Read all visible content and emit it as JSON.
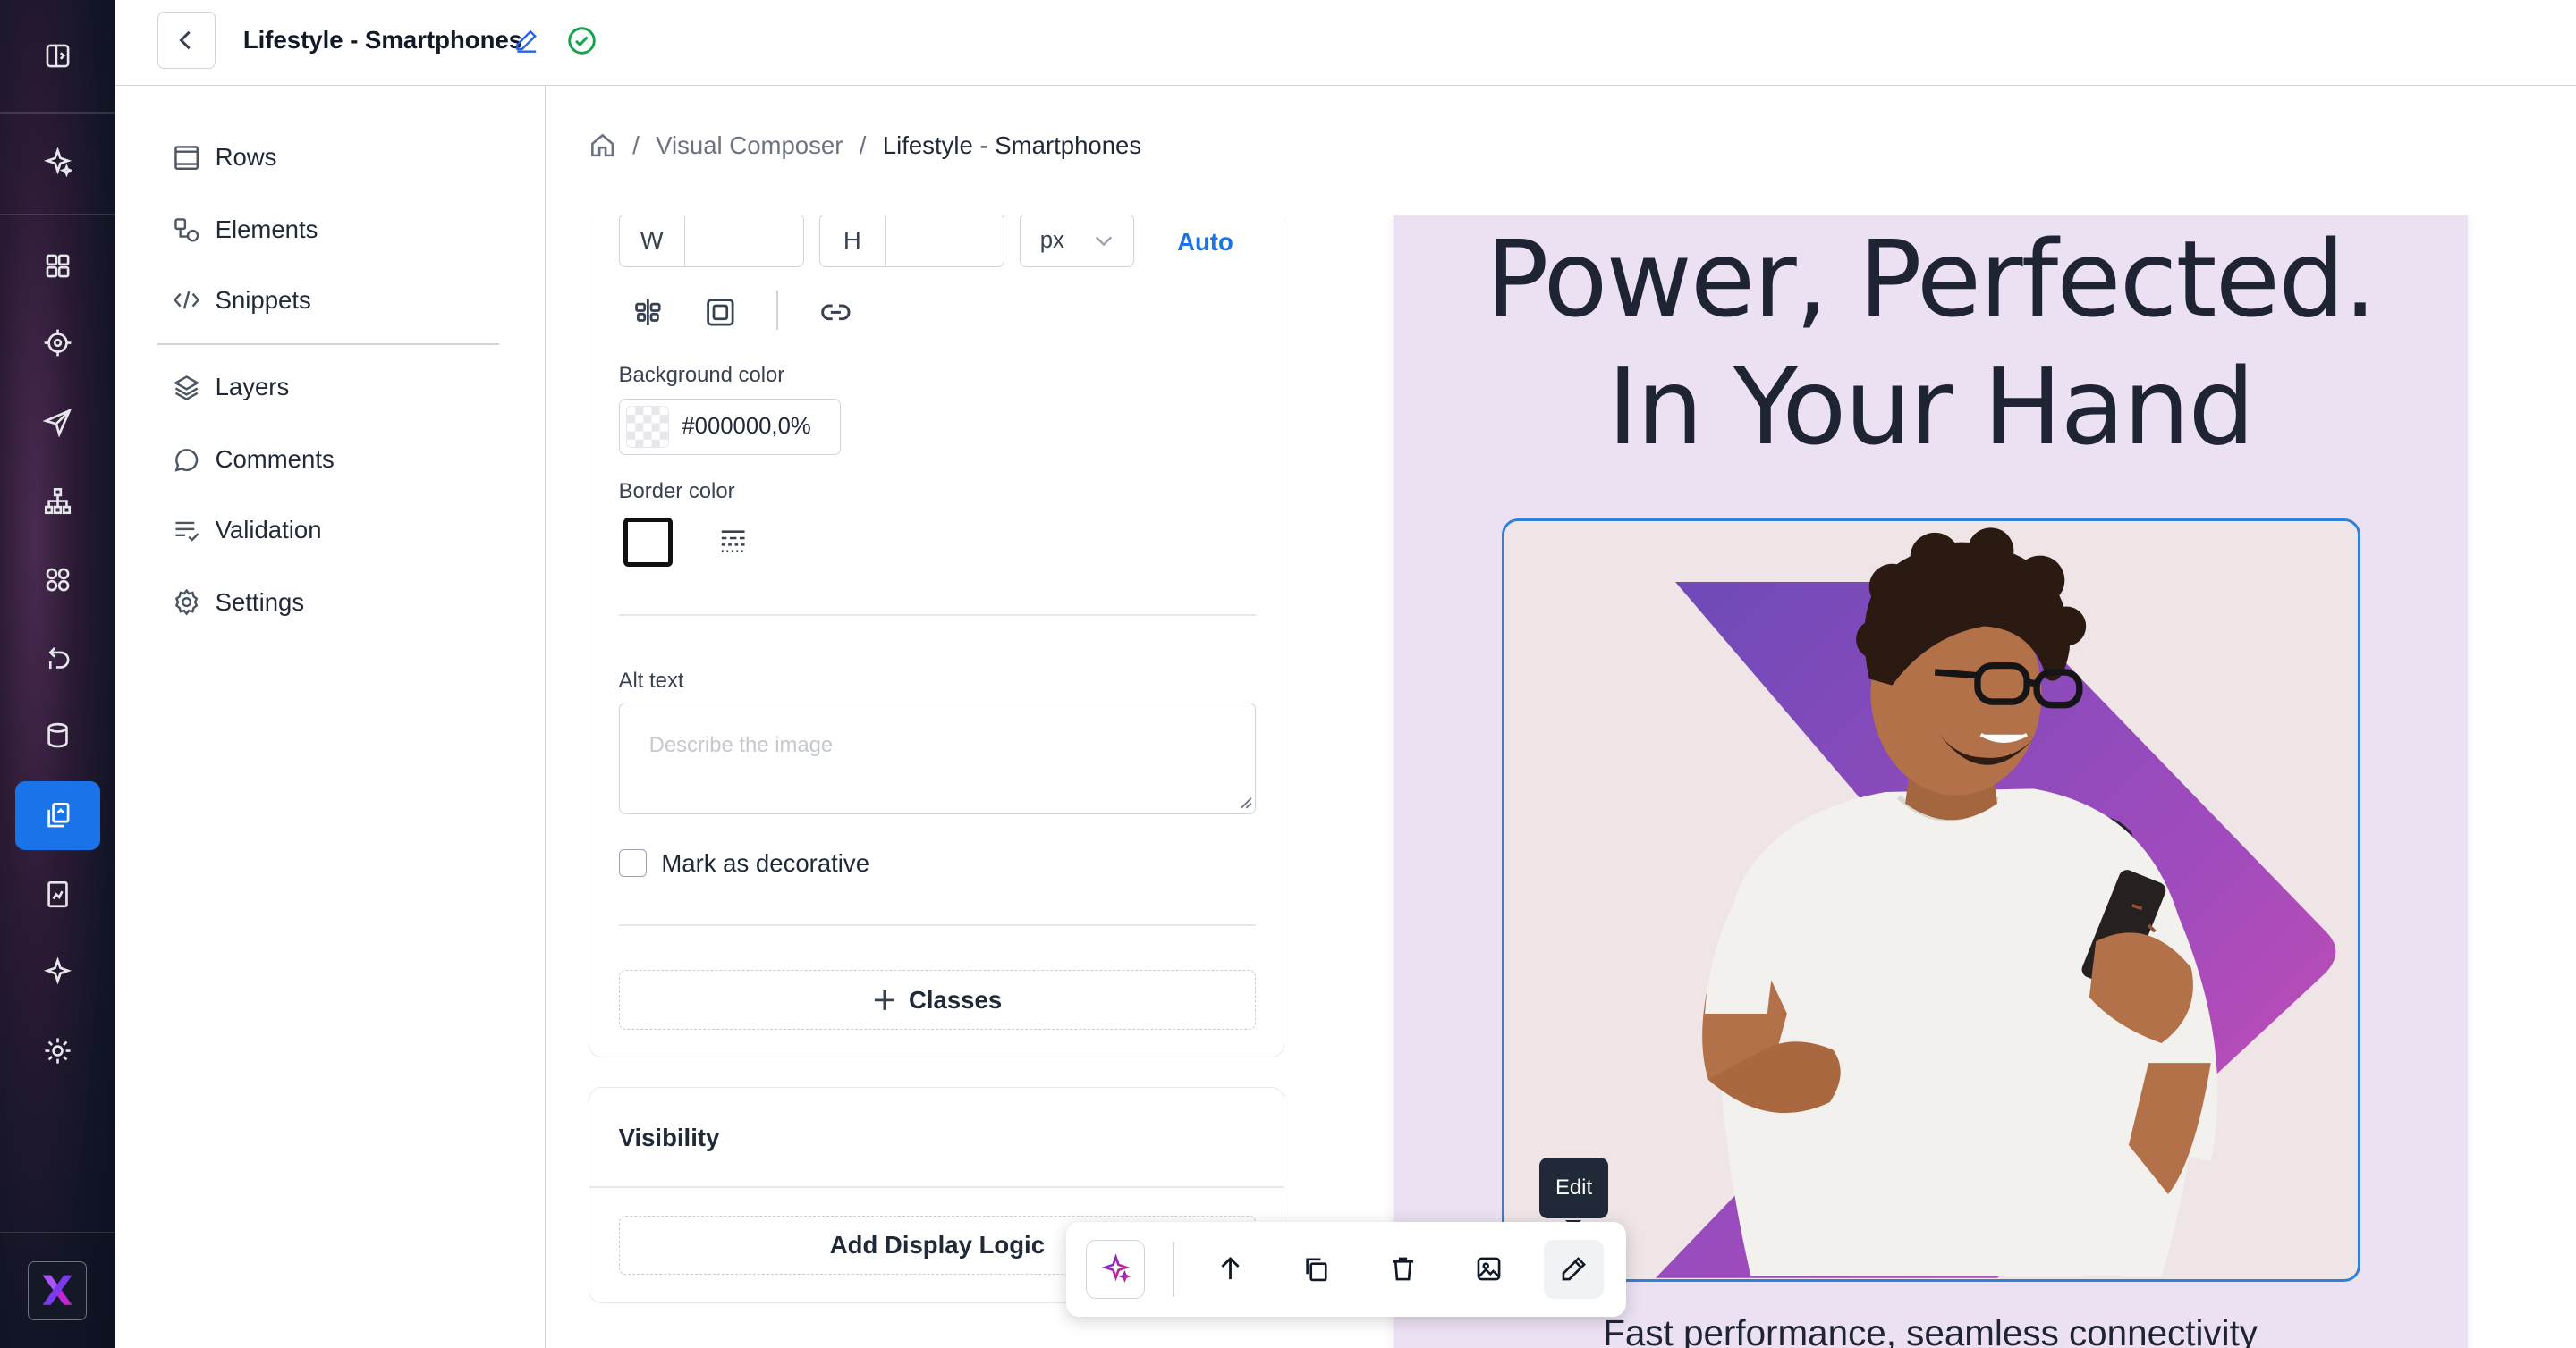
{
  "app": {
    "doc_title": "Lifestyle - Smartphones"
  },
  "menu": {
    "items": [
      {
        "label": "Rows",
        "icon": "rows-icon"
      },
      {
        "label": "Elements",
        "icon": "elements-icon"
      },
      {
        "label": "Snippets",
        "icon": "code-icon"
      },
      {
        "label": "Layers",
        "icon": "layers-icon"
      },
      {
        "label": "Comments",
        "icon": "comment-icon"
      },
      {
        "label": "Validation",
        "icon": "checklist-icon"
      },
      {
        "label": "Settings",
        "icon": "gear-icon"
      }
    ]
  },
  "breadcrumb": {
    "parent": "Visual Composer",
    "current": "Lifestyle - Smartphones",
    "separator": "/"
  },
  "props": {
    "width_label": "W",
    "height_label": "H",
    "width_value": "",
    "height_value": "",
    "unit": "px",
    "auto_label": "Auto",
    "bg_color_label": "Background color",
    "bg_color_value": "#000000,0%",
    "border_color_label": "Border color",
    "alt_text_label": "Alt text",
    "alt_text_placeholder": "Describe the image",
    "decorative_label": "Mark as decorative",
    "classes_label": "Classes"
  },
  "visibility": {
    "title": "Visibility",
    "add_logic_label": "Add Display Logic"
  },
  "canvas": {
    "headline_line1": "Power, Perfected.",
    "headline_line2": "In Your Hand",
    "subheadline": "Fast performance, seamless connectivity"
  },
  "toolbar": {
    "tooltip": "Edit"
  },
  "colors": {
    "accent": "#1a73e8",
    "selection": "#2f80d8",
    "page_bg": "#ece1f3",
    "headline": "#1e2433"
  }
}
